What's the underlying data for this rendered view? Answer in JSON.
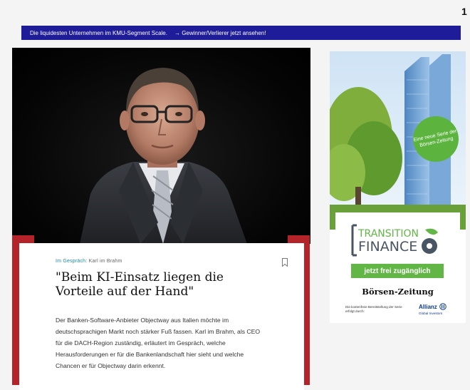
{
  "page_number": "1",
  "banner": {
    "text": "Die liquidesten Unternehmen im KMU-Segment Scale.",
    "link": "→ Gewinner/Verlierer jetzt ansehen!"
  },
  "article": {
    "kicker_topic": "Im Gespräch:",
    "kicker_person": "Karl im Brahm",
    "headline": "\"Beim KI-Einsatz liegen die Vorteile auf der Hand\"",
    "teaser": "Der Banken-Software-Anbieter Objectway aus Italien möchte im deutschsprachigen Markt noch stärker Fuß fassen. Karl im Brahm, als CEO für die DACH-Region zuständig, erläutert im Gespräch, welche Herausforderungen er für die Bankenlandschaft hier sieht und welche Chancen er für Objectway darin erkennt."
  },
  "ad": {
    "close": "×",
    "badge": "Eine neue Serie der Börsen-Zeitung",
    "logo_line1": "TRANSITION",
    "logo_line2": "FINANCE",
    "cta": "jetzt frei zugänglich",
    "brand": "Börsen-Zeitung",
    "disclaimer": "Die kostenfreie Bereitstellung der Serie erfolgt durch:",
    "sponsor": "Allianz",
    "sponsor_sub": "Global Investors",
    "colors": {
      "green": "#62b646",
      "navy": "#0a3a8c"
    }
  },
  "colors": {
    "banner": "#1f1c9a",
    "accent_red": "#b4222a",
    "kicker": "#1e8aa0"
  }
}
